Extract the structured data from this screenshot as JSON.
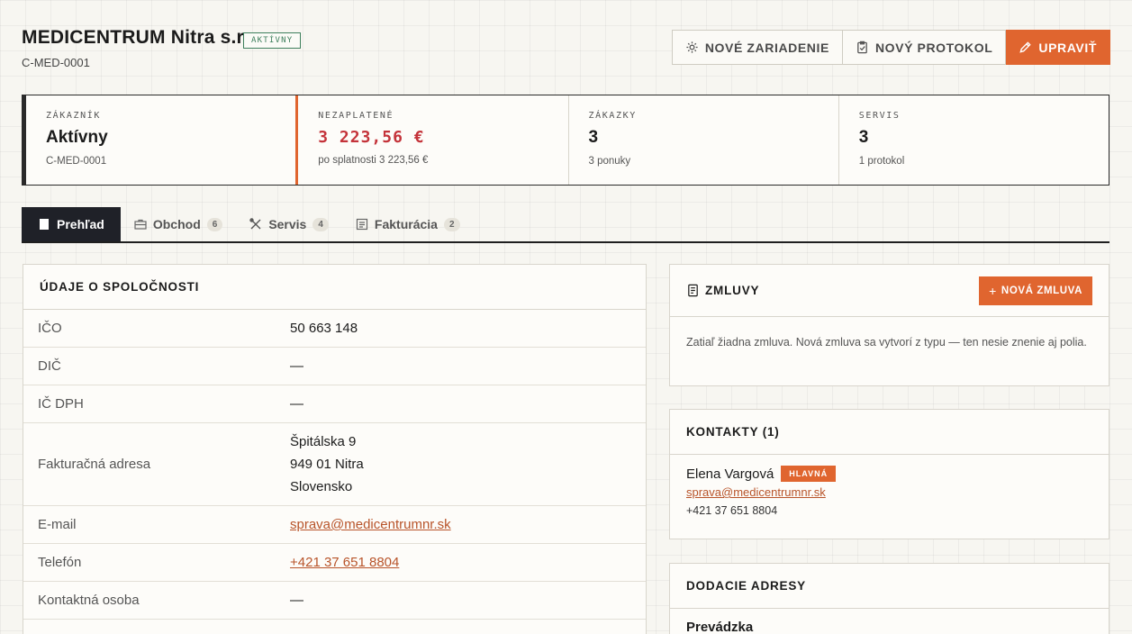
{
  "header": {
    "title": "MEDICENTRUM Nitra s.r.o.",
    "status_badge": "AKTÍVNY",
    "code": "C-MED-0001",
    "actions": {
      "new_device": "NOVÉ ZARIADENIE",
      "new_protocol": "NOVÝ PROTOKOL",
      "edit": "UPRAVIŤ"
    }
  },
  "stats": [
    {
      "label": "ZÁKAZNÍK",
      "value": "Aktívny",
      "sub": "C-MED-0001"
    },
    {
      "label": "NEZAPLATENÉ",
      "value": "3 223,56 €",
      "sub": "po splatnosti 3 223,56 €"
    },
    {
      "label": "ZÁKAZKY",
      "value": "3",
      "sub": "3 ponuky"
    },
    {
      "label": "SERVIS",
      "value": "3",
      "sub": "1 protokol"
    }
  ],
  "tabs": [
    {
      "label": "Prehľad",
      "count": ""
    },
    {
      "label": "Obchod",
      "count": "6"
    },
    {
      "label": "Servis",
      "count": "4"
    },
    {
      "label": "Fakturácia",
      "count": "2"
    }
  ],
  "company": {
    "title": "ÚDAJE O SPOLOČNOSTI",
    "ico": {
      "label": "IČO",
      "value": "50 663 148"
    },
    "dic": {
      "label": "DIČ",
      "value": "—"
    },
    "icdph": {
      "label": "IČ DPH",
      "value": "—"
    },
    "address": {
      "label": "Fakturačná adresa",
      "lines": [
        "Špitálska 9",
        "949 01 Nitra",
        "Slovensko"
      ]
    },
    "email": {
      "label": "E-mail",
      "value": "sprava@medicentrumnr.sk"
    },
    "phone": {
      "label": "Telefón",
      "value": "+421 37 651 8804"
    },
    "contact_person": {
      "label": "Kontaktná osoba",
      "value": "—"
    }
  },
  "contracts": {
    "title": "ZMLUVY",
    "new_button": "NOVÁ ZMLUVA",
    "empty_text": "Zatiaľ žiadna zmluva. Nová zmluva sa vytvorí z typu — ten nesie znenie aj polia."
  },
  "contacts": {
    "title": "KONTAKTY (1)",
    "items": [
      {
        "name": "Elena Vargová",
        "badge": "HLAVNÁ",
        "email": "sprava@medicentrumnr.sk",
        "phone": "+421 37 651 8804"
      }
    ]
  },
  "addresses": {
    "title": "DODACIE ADRESY",
    "items": [
      {
        "name": "Prevádzka"
      }
    ]
  },
  "colors": {
    "accent": "#e0652f",
    "danger": "#c4333a",
    "active_status": "#3e7f5c",
    "dark": "#1f2128"
  }
}
